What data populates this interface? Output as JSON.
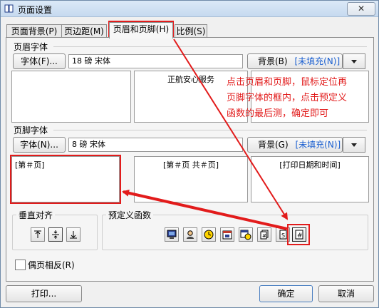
{
  "window": {
    "title": "页面设置",
    "close_glyph": "✕"
  },
  "tabs": [
    {
      "label": "页面背景(P)"
    },
    {
      "label": "页边距(M)"
    },
    {
      "label": "页眉和页脚(H)"
    },
    {
      "label": "比例(S)"
    }
  ],
  "header": {
    "section_title": "页眉字体",
    "font_button": "字体(F)...",
    "font_value": "18 磅 宋体",
    "bg_label": "背景(B)",
    "bg_value": "[未填充(N)]",
    "left_text": "",
    "center_text": "正航安心服务",
    "right_text": ""
  },
  "footer": {
    "section_title": "页脚字体",
    "font_button": "字体(N)...",
    "font_value": "8 磅 宋体",
    "bg_label": "背景(G)",
    "bg_value": "[未填充(N)]",
    "left_text": "[第＃页]",
    "center_text": "[第＃页 共＃页]",
    "right_text": "[打印日期和时间]"
  },
  "vertical_align": {
    "title": "垂直对齐"
  },
  "predefined": {
    "title": "预定义函数"
  },
  "options": {
    "mirror_label": "偶页相反(R)"
  },
  "buttons": {
    "print": "打印...",
    "ok": "确定",
    "cancel": "取消"
  },
  "annotation": {
    "text": "点击页眉和页脚，鼠标定位再\n页脚字体的框内，点击预定义\n函数的最后测，确定即可"
  },
  "colors": {
    "highlight": "#e21b1b",
    "link_blue": "#1a5fd0"
  }
}
